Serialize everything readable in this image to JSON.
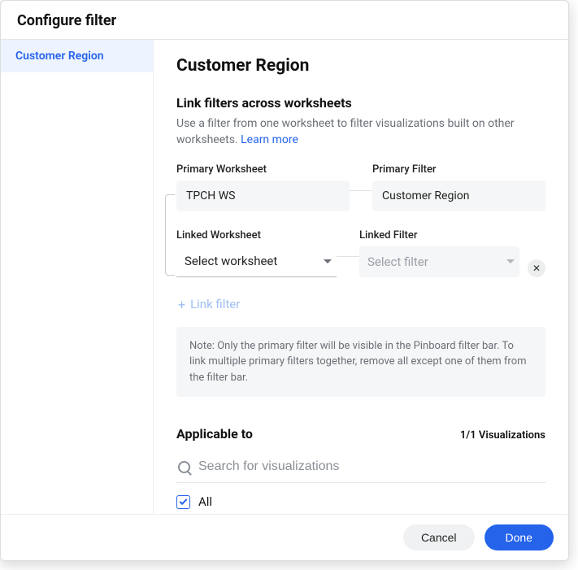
{
  "header": {
    "title": "Configure filter"
  },
  "sidebar": {
    "items": [
      {
        "label": "Customer Region"
      }
    ]
  },
  "main": {
    "title": "Customer Region",
    "link_section": {
      "heading": "Link filters across worksheets",
      "description_prefix": "Use a filter from one worksheet to filter visualizations built on other worksheets. ",
      "learn_more": "Learn more",
      "primary_worksheet_label": "Primary Worksheet",
      "primary_worksheet_value": "TPCH WS",
      "primary_filter_label": "Primary Filter",
      "primary_filter_value": "Customer Region",
      "linked_worksheet_label": "Linked Worksheet",
      "linked_worksheet_value": "Select worksheet",
      "linked_filter_label": "Linked Filter",
      "linked_filter_placeholder": "Select filter",
      "add_link_label": "Link filter",
      "note": "Note: Only the primary filter will be visible in the Pinboard filter bar. To link multiple primary filters together, remove all except one of them from the filter bar."
    },
    "applicable": {
      "heading": "Applicable to",
      "count_label": "1/1 Visualizations",
      "search_placeholder": "Search for visualizations",
      "all_label": "All"
    }
  },
  "footer": {
    "cancel": "Cancel",
    "done": "Done"
  }
}
